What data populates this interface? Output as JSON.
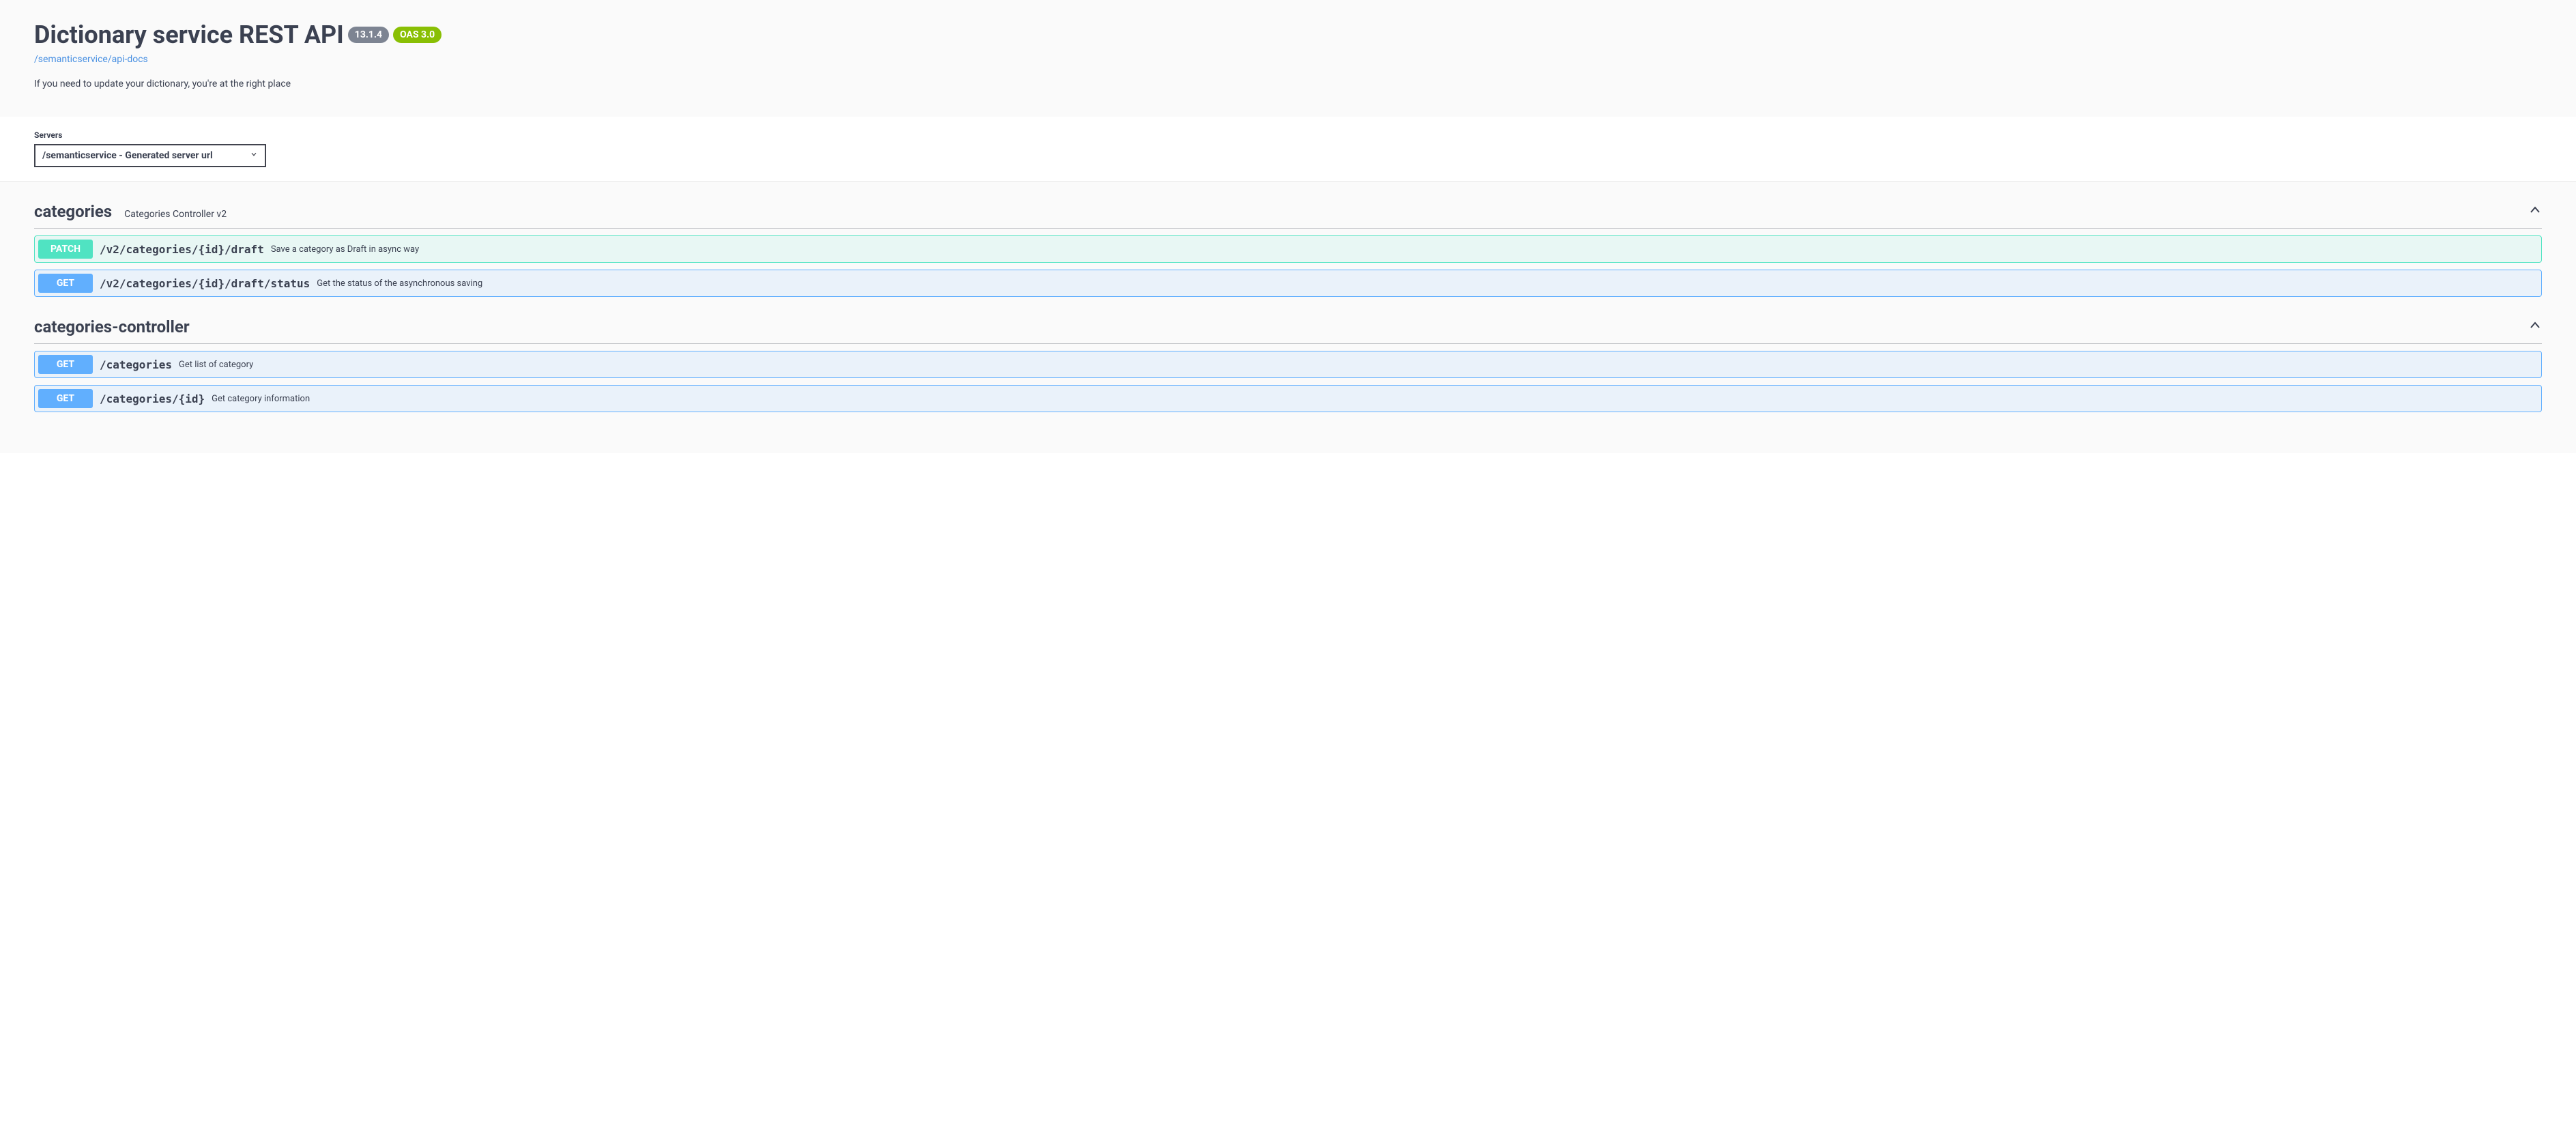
{
  "header": {
    "title": "Dictionary service REST API",
    "version": "13.1.4",
    "oas": "OAS 3.0",
    "docs_link": "/semanticservice/api-docs",
    "description": "If you need to update your dictionary, you're at the right place"
  },
  "servers": {
    "label": "Servers",
    "selected": "/semanticservice - Generated server url"
  },
  "tags": [
    {
      "name": "categories",
      "description": "Categories Controller v2",
      "operations": [
        {
          "method": "PATCH",
          "method_class": "patch",
          "path": "/v2/categories/{id}/draft",
          "summary": "Save a category as Draft in async way"
        },
        {
          "method": "GET",
          "method_class": "get",
          "path": "/v2/categories/{id}/draft/status",
          "summary": "Get the status of the asynchronous saving"
        }
      ]
    },
    {
      "name": "categories-controller",
      "description": "",
      "operations": [
        {
          "method": "GET",
          "method_class": "get",
          "path": "/categories",
          "summary": "Get list of category"
        },
        {
          "method": "GET",
          "method_class": "get",
          "path": "/categories/{id}",
          "summary": "Get category information"
        }
      ]
    }
  ]
}
